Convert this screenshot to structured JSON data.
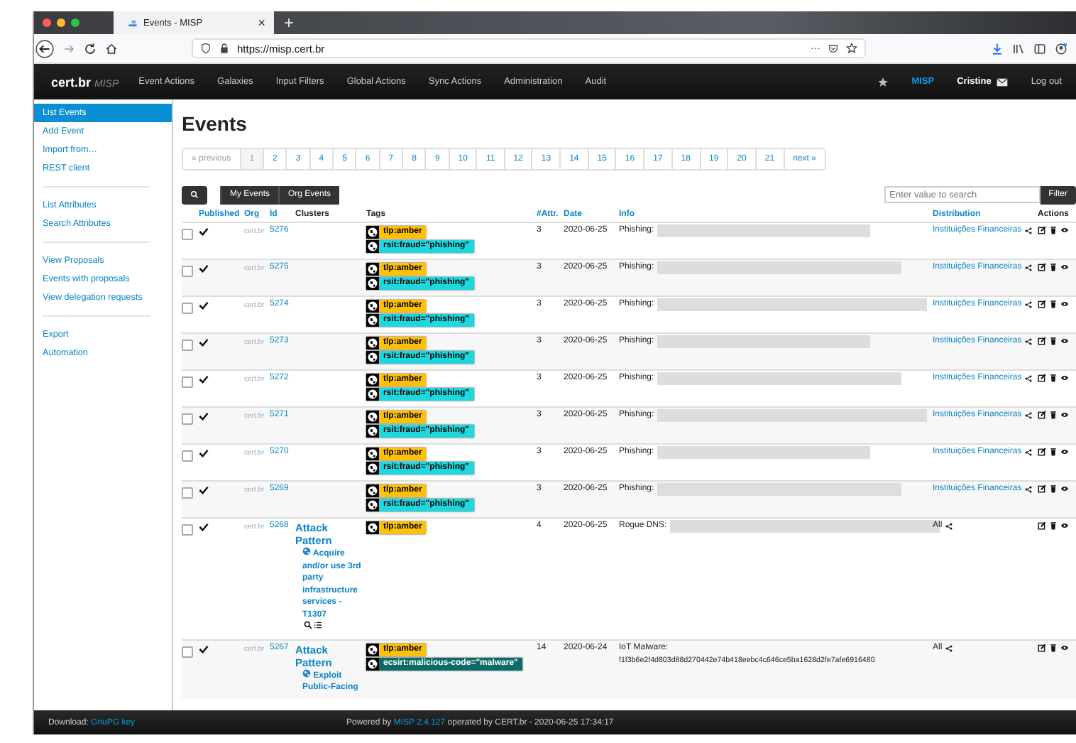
{
  "browser": {
    "tab_title": "Events - MISP",
    "tab_close": "×",
    "new_tab": "+",
    "url": "https://misp.cert.br",
    "page_actions": "···"
  },
  "navbar": {
    "brand": "cert.br",
    "product": "MISP",
    "items": [
      "Event Actions",
      "Galaxies",
      "Input Filters",
      "Global Actions",
      "Sync Actions",
      "Administration",
      "Audit"
    ],
    "instance": "MISP",
    "user": "Cristine",
    "logout": "Log out"
  },
  "sidebar": {
    "groups": [
      [
        {
          "label": "List Events",
          "selected": true
        },
        {
          "label": "Add Event",
          "selected": false
        },
        {
          "label": "Import from…",
          "selected": false
        },
        {
          "label": "REST client",
          "selected": false
        }
      ],
      [
        {
          "label": "List Attributes",
          "selected": false
        },
        {
          "label": "Search Attributes",
          "selected": false
        }
      ],
      [
        {
          "label": "View Proposals",
          "selected": false
        },
        {
          "label": "Events with proposals",
          "selected": false
        },
        {
          "label": "View delegation requests",
          "selected": false
        }
      ],
      [
        {
          "label": "Export",
          "selected": false
        },
        {
          "label": "Automation",
          "selected": false
        }
      ]
    ]
  },
  "page_title": "Events",
  "pagination": {
    "previous": {
      "label": "« previous",
      "disabled": true
    },
    "pages": [
      {
        "label": "1",
        "selected": true
      },
      {
        "label": "2",
        "selected": false
      },
      {
        "label": "3",
        "selected": false
      },
      {
        "label": "4",
        "selected": false
      },
      {
        "label": "5",
        "selected": false
      },
      {
        "label": "6",
        "selected": false
      },
      {
        "label": "7",
        "selected": false
      },
      {
        "label": "8",
        "selected": false
      },
      {
        "label": "9",
        "selected": false
      },
      {
        "label": "10",
        "selected": false
      },
      {
        "label": "11",
        "selected": false
      },
      {
        "label": "12",
        "selected": false
      },
      {
        "label": "13",
        "selected": false
      },
      {
        "label": "14",
        "selected": false
      },
      {
        "label": "15",
        "selected": false
      },
      {
        "label": "16",
        "selected": false
      },
      {
        "label": "17",
        "selected": false
      },
      {
        "label": "18",
        "selected": false
      },
      {
        "label": "19",
        "selected": false
      },
      {
        "label": "20",
        "selected": false
      },
      {
        "label": "21",
        "selected": false
      }
    ],
    "next": {
      "label": "next »",
      "disabled": false
    }
  },
  "toolbar": {
    "filters": [
      "My Events",
      "Org Events"
    ],
    "search": {
      "placeholder": "Enter value to search"
    },
    "filter_button": "Filter"
  },
  "table": {
    "columns": [
      {
        "label": "Published",
        "sortable": true
      },
      {
        "label": "Org",
        "sortable": true
      },
      {
        "label": "Id",
        "sortable": true
      },
      {
        "label": "Clusters",
        "sortable": false
      },
      {
        "label": "Tags",
        "sortable": false
      },
      {
        "label": "#Attr.",
        "sortable": true
      },
      {
        "label": "Date",
        "sortable": true
      },
      {
        "label": "Info",
        "sortable": true
      },
      {
        "label": "Distribution",
        "sortable": true
      },
      {
        "label": "Actions",
        "sortable": false
      }
    ],
    "rows": [
      {
        "checked": false,
        "published": true,
        "org": "cert.br",
        "id": "5276",
        "tags": [
          {
            "label": "tlp:amber",
            "color": "#ffc107"
          },
          {
            "label": "rsit:fraud=\"phishing\"",
            "color": "#1ed8dd"
          }
        ],
        "attributes": "3",
        "date": "2020-06-25",
        "info": {
          "text": "Phishing:",
          "redacted": true
        },
        "distribution": {
          "label": "Instituições Financeiras",
          "link": true
        }
      },
      {
        "checked": false,
        "published": true,
        "org": "cert.br",
        "id": "5275",
        "tags": [
          {
            "label": "tlp:amber",
            "color": "#ffc107"
          },
          {
            "label": "rsit:fraud=\"phishing\"",
            "color": "#1ed8dd"
          }
        ],
        "attributes": "3",
        "date": "2020-06-25",
        "info": {
          "text": "Phishing:",
          "redacted": true
        },
        "distribution": {
          "label": "Instituições Financeiras",
          "link": true
        }
      },
      {
        "checked": false,
        "published": true,
        "org": "cert.br",
        "id": "5274",
        "tags": [
          {
            "label": "tlp:amber",
            "color": "#ffc107"
          },
          {
            "label": "rsit:fraud=\"phishing\"",
            "color": "#1ed8dd"
          }
        ],
        "attributes": "3",
        "date": "2020-06-25",
        "info": {
          "text": "Phishing:",
          "redacted": true
        },
        "distribution": {
          "label": "Instituições Financeiras",
          "link": true
        }
      },
      {
        "checked": false,
        "published": true,
        "org": "cert.br",
        "id": "5273",
        "tags": [
          {
            "label": "tlp:amber",
            "color": "#ffc107"
          },
          {
            "label": "rsit:fraud=\"phishing\"",
            "color": "#1ed8dd"
          }
        ],
        "attributes": "3",
        "date": "2020-06-25",
        "info": {
          "text": "Phishing:",
          "redacted": true
        },
        "distribution": {
          "label": "Instituições Financeiras",
          "link": true
        }
      },
      {
        "checked": false,
        "published": true,
        "org": "cert.br",
        "id": "5272",
        "tags": [
          {
            "label": "tlp:amber",
            "color": "#ffc107"
          },
          {
            "label": "rsit:fraud=\"phishing\"",
            "color": "#1ed8dd"
          }
        ],
        "attributes": "3",
        "date": "2020-06-25",
        "info": {
          "text": "Phishing:",
          "redacted": true
        },
        "distribution": {
          "label": "Instituições Financeiras",
          "link": true
        }
      },
      {
        "checked": false,
        "published": true,
        "org": "cert.br",
        "id": "5271",
        "tags": [
          {
            "label": "tlp:amber",
            "color": "#ffc107"
          },
          {
            "label": "rsit:fraud=\"phishing\"",
            "color": "#1ed8dd"
          }
        ],
        "attributes": "3",
        "date": "2020-06-25",
        "info": {
          "text": "Phishing:",
          "redacted": true
        },
        "distribution": {
          "label": "Instituições Financeiras",
          "link": true
        }
      },
      {
        "checked": false,
        "published": true,
        "org": "cert.br",
        "id": "5270",
        "tags": [
          {
            "label": "tlp:amber",
            "color": "#ffc107"
          },
          {
            "label": "rsit:fraud=\"phishing\"",
            "color": "#1ed8dd"
          }
        ],
        "attributes": "3",
        "date": "2020-06-25",
        "info": {
          "text": "Phishing:",
          "redacted": true
        },
        "distribution": {
          "label": "Instituições Financeiras",
          "link": true
        }
      },
      {
        "checked": false,
        "published": true,
        "org": "cert.br",
        "id": "5269",
        "tags": [
          {
            "label": "tlp:amber",
            "color": "#ffc107"
          },
          {
            "label": "rsit:fraud=\"phishing\"",
            "color": "#1ed8dd"
          }
        ],
        "attributes": "3",
        "date": "2020-06-25",
        "info": {
          "text": "Phishing:",
          "redacted": true
        },
        "distribution": {
          "label": "Instituições Financeiras",
          "link": true
        }
      },
      {
        "checked": false,
        "published": true,
        "org": "cert.br",
        "id": "5268",
        "clusters": [
          {
            "name": "Attack Pattern",
            "items": [
              {
                "label": "Acquire and/or use 3rd party infrastructure services - T1307",
                "tools": true
              }
            ]
          }
        ],
        "tags": [
          {
            "label": "tlp:amber",
            "color": "#ffc107"
          }
        ],
        "attributes": "4",
        "date": "2020-06-25",
        "info": {
          "text": "Rogue DNS:",
          "redacted": true
        },
        "distribution": {
          "label": "All",
          "link": false
        }
      },
      {
        "checked": false,
        "published": true,
        "org": "cert.br",
        "id": "5267",
        "clusters": [
          {
            "name": "Attack Pattern",
            "items": [
              {
                "label": "Exploit Public-Facing",
                "tools": false
              }
            ]
          }
        ],
        "tags": [
          {
            "label": "tlp:amber",
            "color": "#ffc107"
          },
          {
            "label": "ecsirt:malicious-code=\"malware\"",
            "color": "#0b6b66"
          }
        ],
        "attributes": "14",
        "date": "2020-06-24",
        "info": {
          "text": "IoT Malware:",
          "detail": "f1f3b6e2f4d803d88d270442e74b418eebc4c646ce5ba1628d2fe7afe6916480",
          "redacted": false
        },
        "distribution": {
          "label": "All",
          "link": false
        }
      }
    ]
  },
  "footer": {
    "download_label": "Download:",
    "download_link": "GnuPG key",
    "powered_before": "Powered by",
    "powered_link": "MISP 2.4.127",
    "powered_after": "operated by CERT.br - 2020-06-25 17:34:17"
  }
}
